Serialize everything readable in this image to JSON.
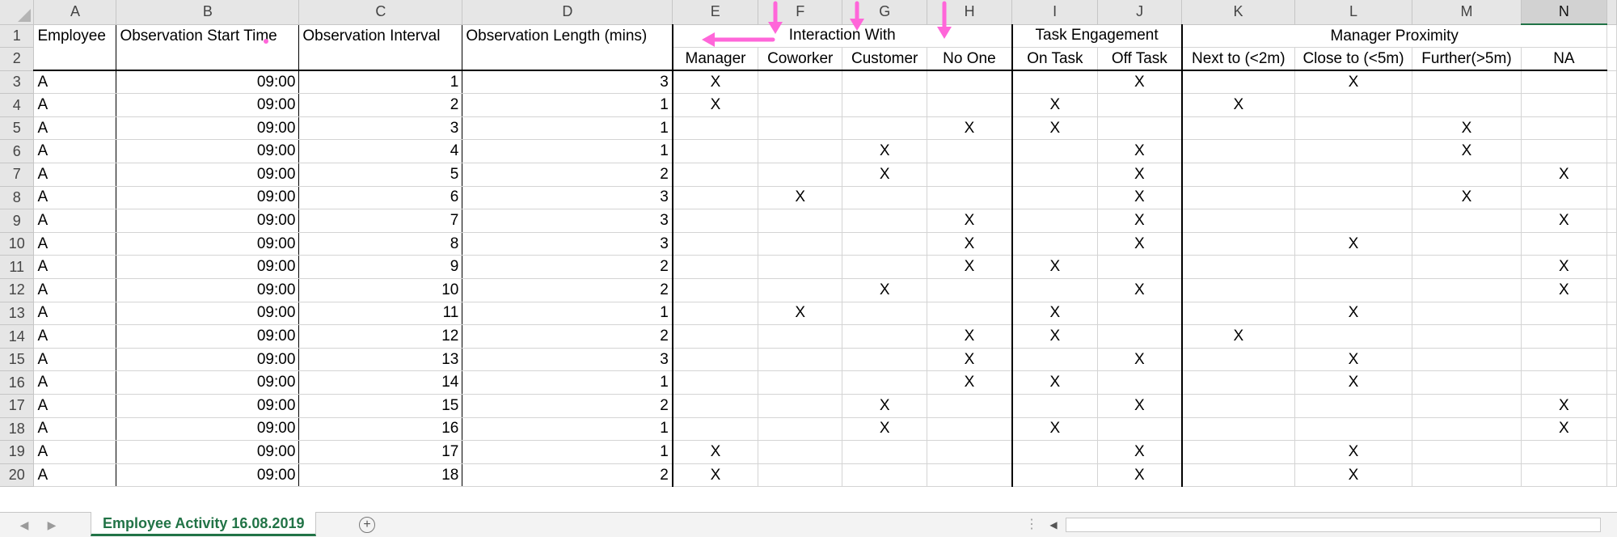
{
  "sheet": {
    "column_letters": [
      "A",
      "B",
      "C",
      "D",
      "E",
      "F",
      "G",
      "H",
      "I",
      "J",
      "K",
      "L",
      "M",
      "N"
    ],
    "selected_column": "N",
    "header_row1": {
      "employee": "Employee",
      "start_time": "Observation Start Time",
      "interval": "Observation Interval",
      "length": "Observation Length (mins)",
      "interaction_with": "Interaction With",
      "task_engagement": "Task Engagement",
      "manager_proximity": "Manager Proximity"
    },
    "header_row2": {
      "manager": "Manager",
      "coworker": "Coworker",
      "customer": "Customer",
      "no_one": "No One",
      "on_task": "On Task",
      "off_task": "Off Task",
      "next_to": "Next to (<2m)",
      "close_to": "Close to (<5m)",
      "further": "Further(>5m)",
      "na": "NA"
    },
    "row_numbers": [
      "1",
      "2",
      "3",
      "4",
      "5",
      "6",
      "7",
      "8",
      "9",
      "10",
      "11",
      "12",
      "13",
      "14",
      "15",
      "16",
      "17",
      "18",
      "19",
      "20"
    ],
    "rows": [
      {
        "A": "A",
        "B": "09:00",
        "C": "1",
        "D": "3",
        "E": "X",
        "F": "",
        "G": "",
        "H": "",
        "I": "",
        "J": "X",
        "K": "",
        "L": "X",
        "M": "",
        "N": ""
      },
      {
        "A": "A",
        "B": "09:00",
        "C": "2",
        "D": "1",
        "E": "X",
        "F": "",
        "G": "",
        "H": "",
        "I": "X",
        "J": "",
        "K": "X",
        "L": "",
        "M": "",
        "N": ""
      },
      {
        "A": "A",
        "B": "09:00",
        "C": "3",
        "D": "1",
        "E": "",
        "F": "",
        "G": "",
        "H": "X",
        "I": "X",
        "J": "",
        "K": "",
        "L": "",
        "M": "X",
        "N": ""
      },
      {
        "A": "A",
        "B": "09:00",
        "C": "4",
        "D": "1",
        "E": "",
        "F": "",
        "G": "X",
        "H": "",
        "I": "",
        "J": "X",
        "K": "",
        "L": "",
        "M": "X",
        "N": ""
      },
      {
        "A": "A",
        "B": "09:00",
        "C": "5",
        "D": "2",
        "E": "",
        "F": "",
        "G": "X",
        "H": "",
        "I": "",
        "J": "X",
        "K": "",
        "L": "",
        "M": "",
        "N": "X"
      },
      {
        "A": "A",
        "B": "09:00",
        "C": "6",
        "D": "3",
        "E": "",
        "F": "X",
        "G": "",
        "H": "",
        "I": "",
        "J": "X",
        "K": "",
        "L": "",
        "M": "X",
        "N": ""
      },
      {
        "A": "A",
        "B": "09:00",
        "C": "7",
        "D": "3",
        "E": "",
        "F": "",
        "G": "",
        "H": "X",
        "I": "",
        "J": "X",
        "K": "",
        "L": "",
        "M": "",
        "N": "X"
      },
      {
        "A": "A",
        "B": "09:00",
        "C": "8",
        "D": "3",
        "E": "",
        "F": "",
        "G": "",
        "H": "X",
        "I": "",
        "J": "X",
        "K": "",
        "L": "X",
        "M": "",
        "N": ""
      },
      {
        "A": "A",
        "B": "09:00",
        "C": "9",
        "D": "2",
        "E": "",
        "F": "",
        "G": "",
        "H": "X",
        "I": "X",
        "J": "",
        "K": "",
        "L": "",
        "M": "",
        "N": "X"
      },
      {
        "A": "A",
        "B": "09:00",
        "C": "10",
        "D": "2",
        "E": "",
        "F": "",
        "G": "X",
        "H": "",
        "I": "",
        "J": "X",
        "K": "",
        "L": "",
        "M": "",
        "N": "X"
      },
      {
        "A": "A",
        "B": "09:00",
        "C": "11",
        "D": "1",
        "E": "",
        "F": "X",
        "G": "",
        "H": "",
        "I": "X",
        "J": "",
        "K": "",
        "L": "X",
        "M": "",
        "N": ""
      },
      {
        "A": "A",
        "B": "09:00",
        "C": "12",
        "D": "2",
        "E": "",
        "F": "",
        "G": "",
        "H": "X",
        "I": "X",
        "J": "",
        "K": "X",
        "L": "",
        "M": "",
        "N": ""
      },
      {
        "A": "A",
        "B": "09:00",
        "C": "13",
        "D": "3",
        "E": "",
        "F": "",
        "G": "",
        "H": "X",
        "I": "",
        "J": "X",
        "K": "",
        "L": "X",
        "M": "",
        "N": ""
      },
      {
        "A": "A",
        "B": "09:00",
        "C": "14",
        "D": "1",
        "E": "",
        "F": "",
        "G": "",
        "H": "X",
        "I": "X",
        "J": "",
        "K": "",
        "L": "X",
        "M": "",
        "N": ""
      },
      {
        "A": "A",
        "B": "09:00",
        "C": "15",
        "D": "2",
        "E": "",
        "F": "",
        "G": "X",
        "H": "",
        "I": "",
        "J": "X",
        "K": "",
        "L": "",
        "M": "",
        "N": "X"
      },
      {
        "A": "A",
        "B": "09:00",
        "C": "16",
        "D": "1",
        "E": "",
        "F": "",
        "G": "X",
        "H": "",
        "I": "X",
        "J": "",
        "K": "",
        "L": "",
        "M": "",
        "N": "X"
      },
      {
        "A": "A",
        "B": "09:00",
        "C": "17",
        "D": "1",
        "E": "X",
        "F": "",
        "G": "",
        "H": "",
        "I": "",
        "J": "X",
        "K": "",
        "L": "X",
        "M": "",
        "N": ""
      },
      {
        "A": "A",
        "B": "09:00",
        "C": "18",
        "D": "2",
        "E": "X",
        "F": "",
        "G": "",
        "H": "",
        "I": "",
        "J": "X",
        "K": "",
        "L": "X",
        "M": "",
        "N": ""
      }
    ]
  },
  "tabs": {
    "active_label": "Employee Activity 16.08.2019",
    "add_icon": "plus-circle-icon",
    "nav_prev_icon": "triangle-left-icon",
    "nav_next_icon": "triangle-right-icon"
  },
  "annotations": {
    "color": "#ff66d9",
    "arrows": [
      "arrow-left-icon",
      "arrow-down-icon",
      "arrow-down-icon",
      "arrow-down-icon"
    ]
  },
  "colors": {
    "accent": "#217346",
    "header_bg": "#e6e6e6",
    "gridline": "#d4d4d4"
  }
}
